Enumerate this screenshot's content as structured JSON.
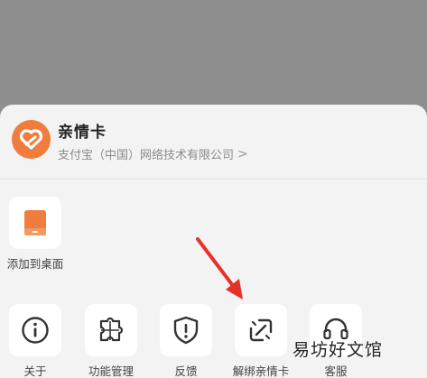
{
  "app": {
    "name": "亲情卡",
    "publisher": "支付宝（中国）网络技术有限公司",
    "chevron": ">",
    "accent": "#ef7d3e"
  },
  "row1": [
    {
      "label": "添加到桌面",
      "icon": "tablet-icon"
    }
  ],
  "row2": [
    {
      "label": "关于",
      "icon": "info-icon"
    },
    {
      "label": "功能管理",
      "icon": "puzzle-icon"
    },
    {
      "label": "反馈",
      "icon": "shield-alert-icon"
    },
    {
      "label": "解绑亲情卡",
      "icon": "unlink-icon"
    },
    {
      "label": "客服",
      "icon": "headset-icon"
    }
  ],
  "annotation": {
    "type": "red-arrow",
    "points_to": "解绑亲情卡",
    "color": "#e8302a"
  },
  "watermark": "易坊好文馆"
}
